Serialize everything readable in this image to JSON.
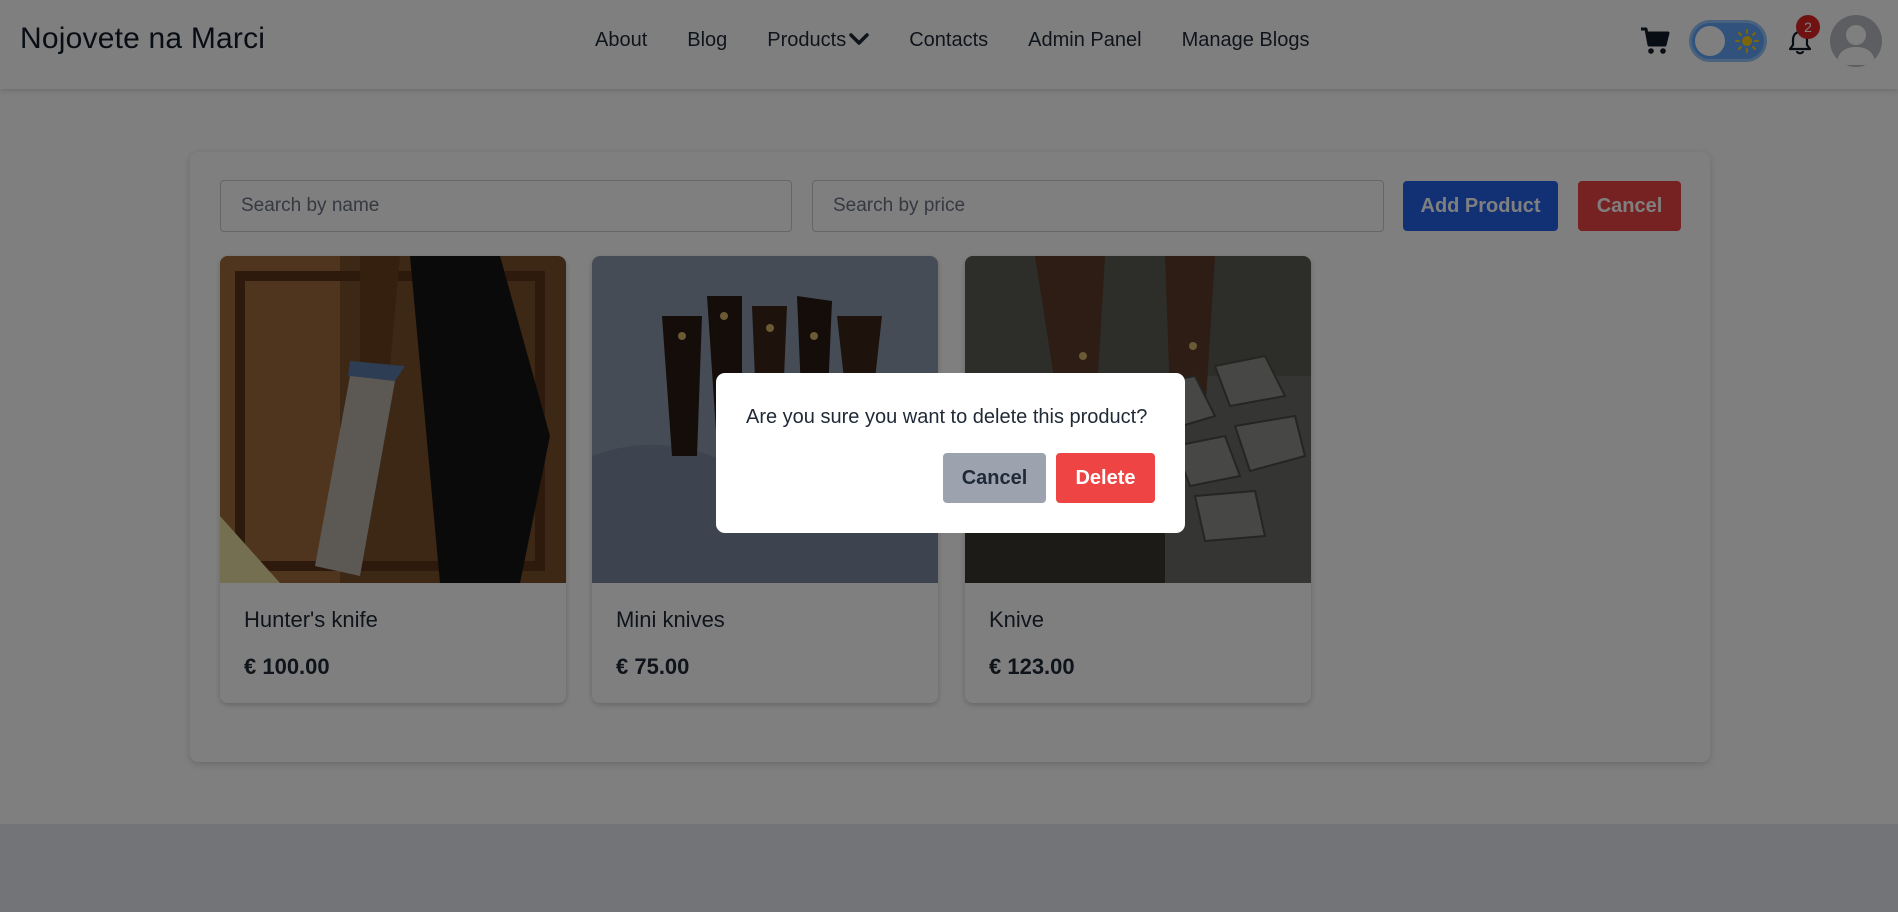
{
  "navbar": {
    "brand": "Nojovete na Marci",
    "links": [
      "About",
      "Blog",
      "Products",
      "Contacts",
      "Admin Panel",
      "Manage Blogs"
    ],
    "notification_count": "2",
    "icons": {
      "cart": "cart-icon",
      "theme": "theme-toggle",
      "bell": "bell-icon",
      "avatar": "user-avatar"
    }
  },
  "search": {
    "name_placeholder": "Search by name",
    "price_placeholder": "Search by price"
  },
  "toolbar": {
    "add_label": "Add Product",
    "cancel_label": "Cancel"
  },
  "products": [
    {
      "name": "Hunter's knife",
      "price": "€ 100.00"
    },
    {
      "name": "Mini knives",
      "price": "€ 75.00"
    },
    {
      "name": "Knive",
      "price": "€ 123.00"
    }
  ],
  "modal": {
    "message": "Are you sure you want to delete this product?",
    "cancel_label": "Cancel",
    "delete_label": "Delete"
  },
  "colors": {
    "primary": "#2563eb",
    "danger": "#ef4444",
    "neutral": "#9ca3af",
    "badge": "#e02424"
  }
}
